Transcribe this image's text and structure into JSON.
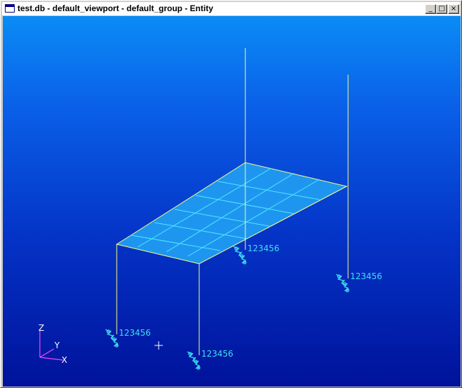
{
  "window": {
    "title": "test.db - default_viewport - default_group - Entity",
    "controls": {
      "minimize_glyph": "_",
      "maximize_glyph": "□",
      "close_glyph": "×"
    }
  },
  "viewport": {
    "background_top": "#0a8cf5",
    "background_bottom": "#00129a",
    "mesh_fill": "#1e96f0",
    "mesh_edge": "#ffff80",
    "mesh_grid": "#50e6ff",
    "constraint_color": "#3fe0f0",
    "constraint_labels": [
      "123456",
      "123456",
      "123456",
      "123456"
    ],
    "triad": {
      "x_label": "X",
      "y_label": "Y",
      "z_label": "Z",
      "color": "#ff40ff"
    },
    "cursor_icon": "crosshair-icon"
  }
}
